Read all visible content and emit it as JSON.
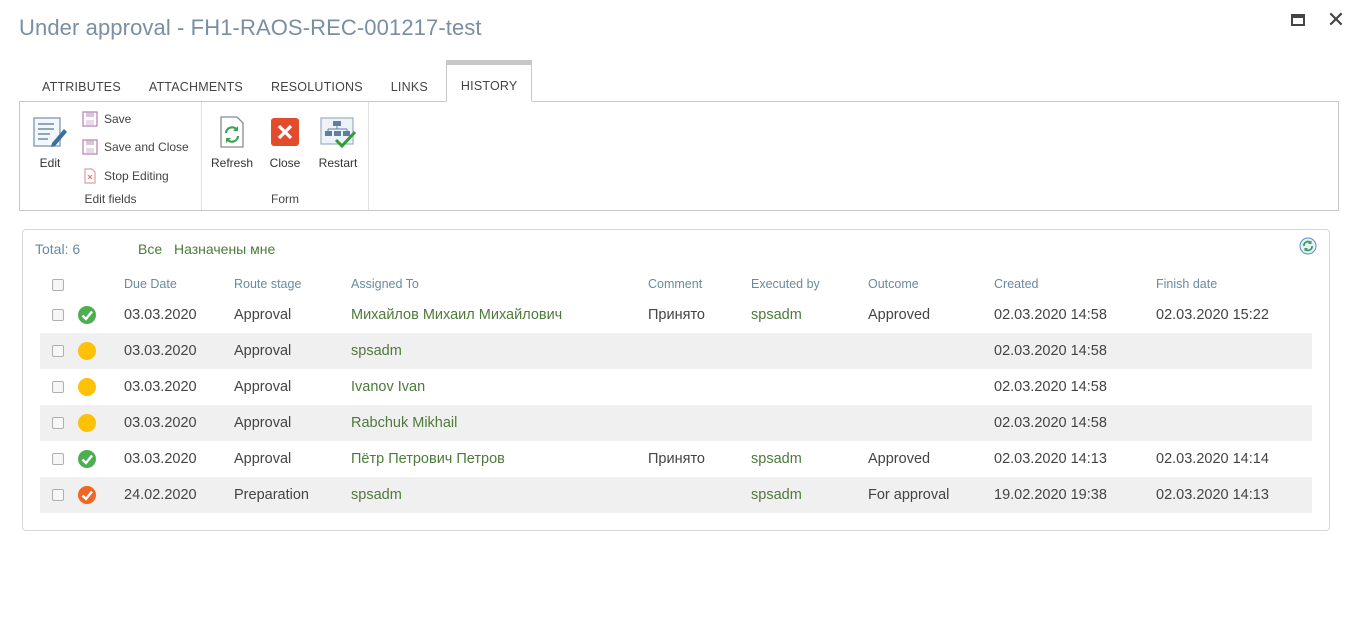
{
  "window": {
    "title": "Under approval - FH1-RAOS-REC-001217-test"
  },
  "tabs": [
    {
      "label": "ATTRIBUTES"
    },
    {
      "label": "ATTACHMENTS"
    },
    {
      "label": "RESOLUTIONS"
    },
    {
      "label": "LINKS"
    },
    {
      "label": "HISTORY"
    }
  ],
  "ribbon": {
    "edit_fields": {
      "group_label": "Edit fields",
      "edit_label": "Edit",
      "save_label": "Save",
      "save_close_label": "Save and Close",
      "stop_editing_label": "Stop Editing"
    },
    "form": {
      "group_label": "Form",
      "refresh_label": "Refresh",
      "close_label": "Close",
      "restart_label": "Restart"
    }
  },
  "history": {
    "total": "Total: 6",
    "filter_all": "Все",
    "filter_mine": "Назначены мне",
    "columns": [
      "Due Date",
      "Route stage",
      "Assigned To",
      "Comment",
      "Executed by",
      "Outcome",
      "Created",
      "Finish date"
    ],
    "rows": [
      {
        "status": "done",
        "due": "03.03.2020",
        "stage": "Approval",
        "assigned": "Михайлов Михаил Михайлович",
        "comment": "Принято",
        "executed": "spsadm",
        "outcome": "Approved",
        "created": "02.03.2020 14:58",
        "finish": "02.03.2020 15:22"
      },
      {
        "status": "pending",
        "due": "03.03.2020",
        "stage": "Approval",
        "assigned": "spsadm",
        "comment": "",
        "executed": "",
        "outcome": "",
        "created": "02.03.2020 14:58",
        "finish": ""
      },
      {
        "status": "pending",
        "due": "03.03.2020",
        "stage": "Approval",
        "assigned": "Ivanov Ivan",
        "comment": "",
        "executed": "",
        "outcome": "",
        "created": "02.03.2020 14:58",
        "finish": ""
      },
      {
        "status": "pending",
        "due": "03.03.2020",
        "stage": "Approval",
        "assigned": "Rabchuk Mikhail",
        "comment": "",
        "executed": "",
        "outcome": "",
        "created": "02.03.2020 14:58",
        "finish": ""
      },
      {
        "status": "done",
        "due": "03.03.2020",
        "stage": "Approval",
        "assigned": "Пётр Петрович Петров",
        "comment": "Принято",
        "executed": "spsadm",
        "outcome": "Approved",
        "created": "02.03.2020 14:13",
        "finish": "02.03.2020 14:14"
      },
      {
        "status": "sent",
        "due": "24.02.2020",
        "stage": "Preparation",
        "assigned": "spsadm",
        "comment": "",
        "executed": "spsadm",
        "outcome": "For approval",
        "created": "19.02.2020 19:38",
        "finish": "02.03.2020 14:13"
      }
    ]
  },
  "colors": {
    "done": "#4caf50",
    "pending": "#ffc107",
    "sent": "#f26522",
    "link": "#4e7a3a"
  },
  "icons": {
    "done": "check-circle-icon",
    "pending": "circle-icon",
    "sent": "check-circle-orange-icon"
  }
}
